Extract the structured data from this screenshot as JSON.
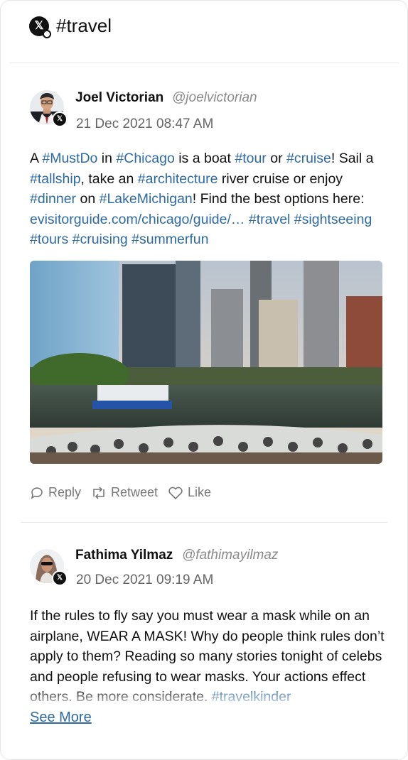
{
  "header": {
    "title": "#travel",
    "logo_icon": "x-logo-icon"
  },
  "posts": [
    {
      "author_name": "Joel Victorian",
      "author_handle": "@joelvictorian",
      "date": "21 Dec 2021 08:47 AM",
      "text": [
        {
          "t": "A ",
          "tag": false
        },
        {
          "t": "#MustDo",
          "tag": true
        },
        {
          "t": " in ",
          "tag": false
        },
        {
          "t": "#Chicago",
          "tag": true
        },
        {
          "t": " is a boat ",
          "tag": false
        },
        {
          "t": "#tour",
          "tag": true
        },
        {
          "t": " or ",
          "tag": false
        },
        {
          "t": "#cruise",
          "tag": true
        },
        {
          "t": "! Sail a ",
          "tag": false
        },
        {
          "t": "#tallship",
          "tag": true
        },
        {
          "t": ", take an ",
          "tag": false
        },
        {
          "t": "#architecture",
          "tag": true
        },
        {
          "t": " river cruise or enjoy ",
          "tag": false
        },
        {
          "t": "#dinner",
          "tag": true
        },
        {
          "t": " on ",
          "tag": false
        },
        {
          "t": "#LakeMichigan",
          "tag": true
        },
        {
          "t": "! Find the best options here: ",
          "tag": false
        },
        {
          "t": "evisitorguide.com/chicago/guide/…",
          "tag": true
        },
        {
          "t": " ",
          "tag": false
        },
        {
          "t": "#travel",
          "tag": true
        },
        {
          "t": " ",
          "tag": false
        },
        {
          "t": "#sightseeing",
          "tag": true
        },
        {
          "t": " ",
          "tag": false
        },
        {
          "t": "#tours",
          "tag": true
        },
        {
          "t": " ",
          "tag": false
        },
        {
          "t": "#cruising",
          "tag": true
        },
        {
          "t": " ",
          "tag": false
        },
        {
          "t": "#summerfun",
          "tag": true
        }
      ],
      "actions": {
        "reply": "Reply",
        "retweet": "Retweet",
        "like": "Like"
      }
    },
    {
      "author_name": "Fathima Yilmaz",
      "author_handle": "@fathimayilmaz",
      "date": "20 Dec 2021 09:19 AM",
      "text": [
        {
          "t": "If the rules to fly say you must wear a mask while on an airplane, WEAR A MASK! Why do people think rules don’t apply to them? Reading so many stories tonight of celebs and people refusing to wear masks. Your actions effect others. Be more considerate. ",
          "tag": false
        },
        {
          "t": "#travelkinder",
          "tag": true
        }
      ],
      "see_more": "See More"
    }
  ],
  "colors": {
    "hashtag": "#2d6aa3",
    "muted": "#8a8a8a",
    "text": "#111111"
  }
}
